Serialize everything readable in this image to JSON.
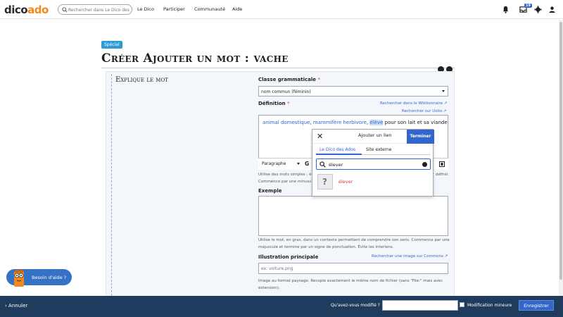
{
  "header": {
    "logo_part1": "dico",
    "logo_part2": "ado",
    "search_placeholder": "Rechercher dans Le Dico des Ados",
    "nav": [
      "Le Dico",
      "Participer",
      "Communauté",
      "Aide"
    ],
    "notification_count": "19"
  },
  "page": {
    "tag": "Spécial",
    "title": "Créer Ajouter un mot : vache"
  },
  "form": {
    "section_title": "Explique le mot",
    "class_label": "Classe grammaticale",
    "class_value": "nom commun (féminin)",
    "def_label": "Définition",
    "required_mark": "*",
    "wiktionnaire_link": "Rechercher dans le Wiktionnaire",
    "usito_link": "Rechercher sur Usito",
    "definition_parts": {
      "link1": "animal domestique",
      "sep1": ", ",
      "link2": "mammifère herbivore",
      "sep2": ", ",
      "selected": "élève",
      "rest": " pour son lait et sa viande"
    },
    "toolbar_format": "Paragraphe",
    "toolbar_bold": "G",
    "def_help_line1": "Utilise des mots simples ; év",
    "def_help_line1_end": "définir.",
    "def_help_line2": "Commence par une minusc",
    "example_label": "Exemple",
    "example_help": "Utilise le mot, en gras, dans un contexte permettant de comprendre son sens. Commence par une majuscule et termine par un signe de ponctuation. Évite les interlens.",
    "illustration_label": "Illustration principale",
    "commons_link": "Rechercher une image sur Commons",
    "illustration_placeholder": "ex: voiture.png",
    "illustration_help": "Image au format paysage. Recopie exactement le même nom de fichier (sans \"File:\" mais avec extension)."
  },
  "link_popup": {
    "title": "Ajouter un lien",
    "done": "Terminer",
    "tabs": [
      "Le Dico des Ados",
      "Site externe"
    ],
    "search_value": "élever",
    "result": "élever",
    "result_thumb": "?"
  },
  "help_bubble": "Besoin d'aide ?",
  "bottom": {
    "cancel": "Annuler",
    "summary_label": "Qu'avez-vous modifié ?",
    "minor_label": "Modification mineure",
    "save": "Enregistrer"
  },
  "colors": {
    "accent": "#3366cc",
    "logo_orange": "#f08a1c",
    "bottom_bar": "#1f3c5e",
    "required": "#dd3333"
  }
}
